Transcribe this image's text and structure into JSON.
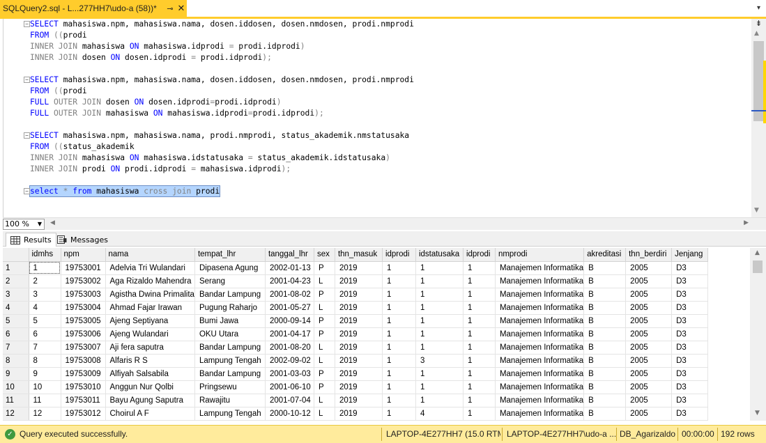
{
  "tab": {
    "title": "SQLQuery2.sql - L...277HH7\\udo-a (58))*",
    "pin_icon": "pin-icon",
    "close_icon": "close-icon"
  },
  "editor": {
    "lines": [
      [
        {
          "t": "SELECT",
          "c": "kw"
        },
        {
          "t": " mahasiswa.npm, mahasiswa.nama, dosen.iddosen, dosen.nmdosen, prodi.nmprodi"
        }
      ],
      [
        {
          "t": "FROM",
          "c": "kw"
        },
        {
          "t": " ((",
          "c": "gray"
        },
        {
          "t": "prodi"
        }
      ],
      [
        {
          "t": "INNER JOIN",
          "c": "gray"
        },
        {
          "t": " mahasiswa "
        },
        {
          "t": "ON",
          "c": "kw"
        },
        {
          "t": " mahasiswa.idprodi "
        },
        {
          "t": "=",
          "c": "gray"
        },
        {
          "t": " prodi.idprodi"
        },
        {
          "t": ")",
          "c": "gray"
        }
      ],
      [
        {
          "t": "INNER JOIN",
          "c": "gray"
        },
        {
          "t": " dosen "
        },
        {
          "t": "ON",
          "c": "kw"
        },
        {
          "t": " dosen.idprodi "
        },
        {
          "t": "=",
          "c": "gray"
        },
        {
          "t": " prodi.idprodi"
        },
        {
          "t": ");",
          "c": "gray"
        }
      ],
      [],
      [
        {
          "t": "SELECT",
          "c": "kw"
        },
        {
          "t": " mahasiswa.npm, mahasiswa.nama, dosen.iddosen, dosen.nmdosen, prodi.nmprodi"
        }
      ],
      [
        {
          "t": "FROM",
          "c": "kw"
        },
        {
          "t": " ((",
          "c": "gray"
        },
        {
          "t": "prodi"
        }
      ],
      [
        {
          "t": "FULL",
          "c": "kw"
        },
        {
          "t": " OUTER JOIN",
          "c": "gray"
        },
        {
          "t": " dosen "
        },
        {
          "t": "ON",
          "c": "kw"
        },
        {
          "t": " dosen.idprodi"
        },
        {
          "t": "=",
          "c": "gray"
        },
        {
          "t": "prodi.idprodi"
        },
        {
          "t": ")",
          "c": "gray"
        }
      ],
      [
        {
          "t": "FULL",
          "c": "kw"
        },
        {
          "t": " OUTER JOIN",
          "c": "gray"
        },
        {
          "t": " mahasiswa "
        },
        {
          "t": "ON",
          "c": "kw"
        },
        {
          "t": " mahasiswa.idprodi"
        },
        {
          "t": "=",
          "c": "gray"
        },
        {
          "t": "prodi.idprodi"
        },
        {
          "t": ");",
          "c": "gray"
        }
      ],
      [],
      [
        {
          "t": "SELECT",
          "c": "kw"
        },
        {
          "t": " mahasiswa.npm, mahasiswa.nama, prodi.nmprodi, status_akademik.nmstatusaka"
        }
      ],
      [
        {
          "t": "FROM",
          "c": "kw"
        },
        {
          "t": " ((",
          "c": "gray"
        },
        {
          "t": "status_akademik"
        }
      ],
      [
        {
          "t": "INNER JOIN",
          "c": "gray"
        },
        {
          "t": " mahasiswa "
        },
        {
          "t": "ON",
          "c": "kw"
        },
        {
          "t": " mahasiswa.idstatusaka "
        },
        {
          "t": "=",
          "c": "gray"
        },
        {
          "t": " status_akademik.idstatusaka"
        },
        {
          "t": ")",
          "c": "gray"
        }
      ],
      [
        {
          "t": "INNER JOIN",
          "c": "gray"
        },
        {
          "t": " prodi "
        },
        {
          "t": "ON",
          "c": "kw"
        },
        {
          "t": " prodi.idprodi "
        },
        {
          "t": "=",
          "c": "gray"
        },
        {
          "t": " mahasiswa.idprodi"
        },
        {
          "t": ");",
          "c": "gray"
        }
      ],
      [],
      [
        {
          "t": "select",
          "c": "kw"
        },
        {
          "t": " "
        },
        {
          "t": "*",
          "c": "gray"
        },
        {
          "t": " "
        },
        {
          "t": "from",
          "c": "kw"
        },
        {
          "t": " mahasiswa "
        },
        {
          "t": "cross join",
          "c": "gray"
        },
        {
          "t": " prodi"
        }
      ]
    ],
    "selected_line": 15
  },
  "zoom": {
    "value": "100 %"
  },
  "result_tabs": [
    {
      "label": "Results",
      "icon": "grid-icon"
    },
    {
      "label": "Messages",
      "icon": "messages-icon"
    }
  ],
  "grid": {
    "columns": [
      "idmhs",
      "npm",
      "nama",
      "tempat_lhr",
      "tanggal_lhr",
      "sex",
      "thn_masuk",
      "idprodi",
      "idstatusaka",
      "idprodi",
      "nmprodi",
      "akreditasi",
      "thn_berdiri",
      "Jenjang"
    ],
    "rows": [
      [
        "1",
        "1",
        "19753001",
        "Adelvia Tri Wulandari",
        "Dipasena Agung",
        "2002-01-13",
        "P",
        "2019",
        "1",
        "1",
        "1",
        "Manajemen Informatika",
        "B",
        "2005",
        "D3"
      ],
      [
        "2",
        "2",
        "19753002",
        "Aga Rizaldo Mahendra",
        "Serang",
        "2001-04-23",
        "L",
        "2019",
        "1",
        "1",
        "1",
        "Manajemen Informatika",
        "B",
        "2005",
        "D3"
      ],
      [
        "3",
        "3",
        "19753003",
        "Agistha Dwina Primalita",
        "Bandar Lampung",
        "2001-08-02",
        "P",
        "2019",
        "1",
        "1",
        "1",
        "Manajemen Informatika",
        "B",
        "2005",
        "D3"
      ],
      [
        "4",
        "4",
        "19753004",
        "Ahmad Fajar Irawan",
        "Pugung Raharjo",
        "2001-05-27",
        "L",
        "2019",
        "1",
        "1",
        "1",
        "Manajemen Informatika",
        "B",
        "2005",
        "D3"
      ],
      [
        "5",
        "5",
        "19753005",
        "Ajeng Septiyana",
        "Bumi Jawa",
        "2000-09-14",
        "P",
        "2019",
        "1",
        "1",
        "1",
        "Manajemen Informatika",
        "B",
        "2005",
        "D3"
      ],
      [
        "6",
        "6",
        "19753006",
        "Ajeng Wulandari",
        "OKU Utara",
        "2001-04-17",
        "P",
        "2019",
        "1",
        "1",
        "1",
        "Manajemen Informatika",
        "B",
        "2005",
        "D3"
      ],
      [
        "7",
        "7",
        "19753007",
        "Aji fera saputra",
        "Bandar Lampung",
        "2001-08-20",
        "L",
        "2019",
        "1",
        "1",
        "1",
        "Manajemen Informatika",
        "B",
        "2005",
        "D3"
      ],
      [
        "8",
        "8",
        "19753008",
        "Alfaris R S",
        "Lampung Tengah",
        "2002-09-02",
        "L",
        "2019",
        "1",
        "3",
        "1",
        "Manajemen Informatika",
        "B",
        "2005",
        "D3"
      ],
      [
        "9",
        "9",
        "19753009",
        "Alfiyah Salsabila",
        "Bandar Lampung",
        "2001-03-03",
        "P",
        "2019",
        "1",
        "1",
        "1",
        "Manajemen Informatika",
        "B",
        "2005",
        "D3"
      ],
      [
        "10",
        "10",
        "19753010",
        "Anggun Nur Qolbi",
        "Pringsewu",
        "2001-06-10",
        "P",
        "2019",
        "1",
        "1",
        "1",
        "Manajemen Informatika",
        "B",
        "2005",
        "D3"
      ],
      [
        "11",
        "11",
        "19753011",
        "Bayu Agung Saputra",
        "Rawajitu",
        "2001-07-04",
        "L",
        "2019",
        "1",
        "1",
        "1",
        "Manajemen Informatika",
        "B",
        "2005",
        "D3"
      ],
      [
        "12",
        "12",
        "19753012",
        "Choirul A F",
        "Lampung Tengah",
        "2000-10-12",
        "L",
        "2019",
        "1",
        "4",
        "1",
        "Manajemen Informatika",
        "B",
        "2005",
        "D3"
      ]
    ]
  },
  "status": {
    "icon": "check-icon",
    "message": "Query executed successfully.",
    "server": "LAPTOP-4E277HH7 (15.0 RTM)",
    "login": "LAPTOP-4E277HH7\\udo-a ...",
    "database": "DB_Agarizaldo",
    "elapsed": "00:00:00",
    "rows": "192 rows"
  }
}
